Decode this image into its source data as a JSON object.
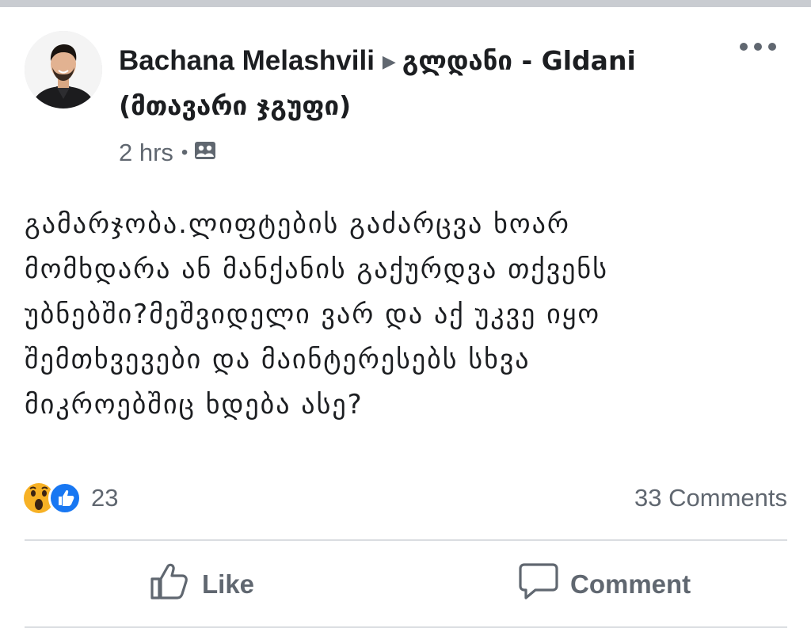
{
  "post": {
    "author": "Bachana Melashvili",
    "separator": "▶",
    "group_name": "გლდანი - Gldani (მთავარი ჯგუფი)",
    "time": "2 hrs",
    "meta_dot": "•",
    "privacy_icon": "group-audience-icon",
    "body": "გამარჯობა.ლიფტების გაძარცვა ხოარ\nმომხდარა ან მანქანის გაქურდვა თქვენს\nუბნებში?მეშვიდელი ვარ და აქ უკვე იყო\nშემთხვევები და მაინტერესებს სხვა\nმიკროებშიც ხდება ასე?",
    "reactions": {
      "icons": [
        "wow-reaction-icon",
        "like-reaction-icon"
      ],
      "count": "23"
    },
    "comments_label": "33 Comments",
    "actions": {
      "like_label": "Like",
      "comment_label": "Comment"
    }
  },
  "colors": {
    "text_primary": "#1c1e21",
    "text_secondary": "#606770",
    "like_blue": "#1877f2",
    "wow_yellow": "#f7b125"
  }
}
